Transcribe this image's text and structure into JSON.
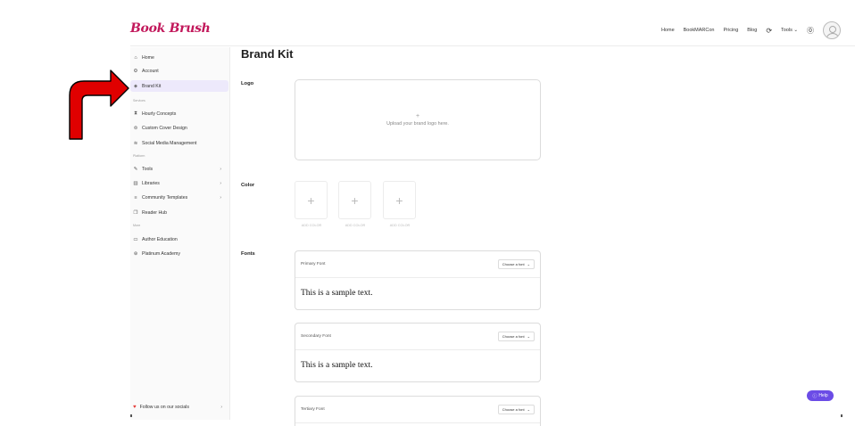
{
  "brand": {
    "logo_text": "Book Brush"
  },
  "topnav": {
    "items": [
      "Home",
      "BookMARCon",
      "Pricing",
      "Blog"
    ],
    "tools_label": "Tools",
    "icons": [
      "refresh-icon",
      "chevron-down-icon",
      "help-circle-icon",
      "user-avatar"
    ]
  },
  "sidebar": {
    "primary": [
      {
        "label": "Home",
        "icon": "home-icon"
      },
      {
        "label": "Account",
        "icon": "gear-icon"
      },
      {
        "label": "Brand Kit",
        "icon": "palette-icon",
        "active": true
      }
    ],
    "services_label": "Services",
    "services": [
      {
        "label": "Hourly Concepts",
        "icon": "hourglass-icon"
      },
      {
        "label": "Custom Cover Design",
        "icon": "book-icon"
      },
      {
        "label": "Social Media Management",
        "icon": "wifi-icon"
      }
    ],
    "platform_label": "Platform",
    "platform": [
      {
        "label": "Tools",
        "icon": "wrench-icon",
        "has_arrow": true
      },
      {
        "label": "Libraries",
        "icon": "library-icon",
        "has_arrow": true
      },
      {
        "label": "Community Templates",
        "icon": "list-icon",
        "has_arrow": true
      },
      {
        "label": "Reader Hub",
        "icon": "book-open-icon"
      }
    ],
    "more_label": "More",
    "more": [
      {
        "label": "Author Education",
        "icon": "video-icon"
      },
      {
        "label": "Platinum Academy",
        "icon": "badge-icon"
      }
    ],
    "follow_label": "Follow us on our socials"
  },
  "main": {
    "title": "Brand Kit",
    "logo_label": "Logo",
    "upload_plus": "+",
    "upload_text": "Upload your brand logo here.",
    "color_label": "Color",
    "color_swatches": [
      {
        "plus": "+",
        "label": "ADD COLOR"
      },
      {
        "plus": "+",
        "label": "ADD COLOR"
      },
      {
        "plus": "+",
        "label": "ADD COLOR"
      }
    ],
    "fonts_label": "Fonts",
    "fonts": [
      {
        "name": "Primary Font",
        "select": "Choose a font",
        "sample": "This is a sample text."
      },
      {
        "name": "Secondary Font",
        "select": "Choose a font",
        "sample": "This is a sample text."
      },
      {
        "name": "Tertiary Font",
        "select": "Choose a font",
        "sample": ""
      }
    ]
  },
  "help": {
    "label": "Help"
  },
  "colors": {
    "accent": "#6b4ce6",
    "active_bg": "#ede9fb",
    "brand": "#c2185b",
    "arrow_red": "#e00000"
  }
}
